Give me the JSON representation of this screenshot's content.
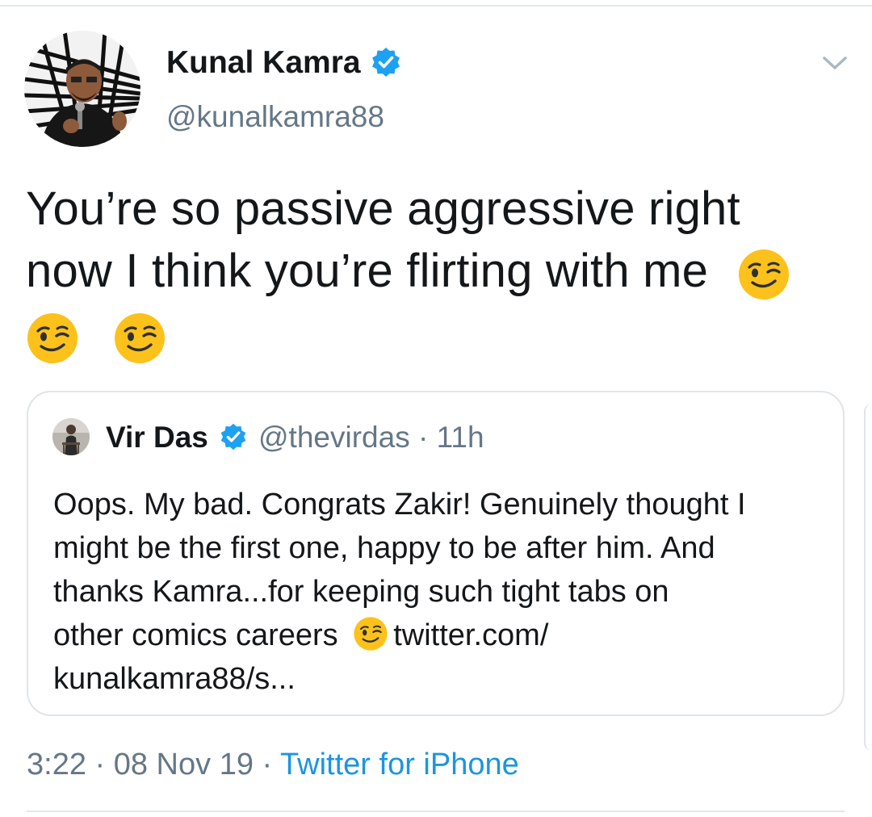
{
  "tweet": {
    "author": {
      "name": "Kunal Kamra",
      "handle": "@kunalkamra88",
      "verified": true,
      "avatar_icon": "avatar-photo"
    },
    "menu_icon": "chevron-down-icon",
    "text_lines": [
      "You’re so passive aggressive right",
      "now I think you’re flirting with me"
    ],
    "emoji": "winking-face-emoji",
    "timestamp": "3:22 · 08 Nov 19 · ",
    "source": "Twitter for iPhone"
  },
  "quoted_tweet": {
    "author": {
      "name": "Vir Das",
      "handle": "@thevirdas · 11h",
      "verified": true,
      "avatar_icon": "avatar-photo"
    },
    "text_lines": [
      "Oops. My bad. Congrats Zakir! Genuinely thought I",
      "might be the first one, happy to be after him. And",
      "thanks Kamra...for keeping such tight tabs on",
      "other comics careers",
      "twitter.com/",
      "kunalkamra88/s..."
    ]
  },
  "colors": {
    "primary_text": "#14171a",
    "secondary_text": "#657786",
    "link": "#1b95e0",
    "verified_badge": "#1da1f2",
    "border": "#dfe5ea"
  }
}
